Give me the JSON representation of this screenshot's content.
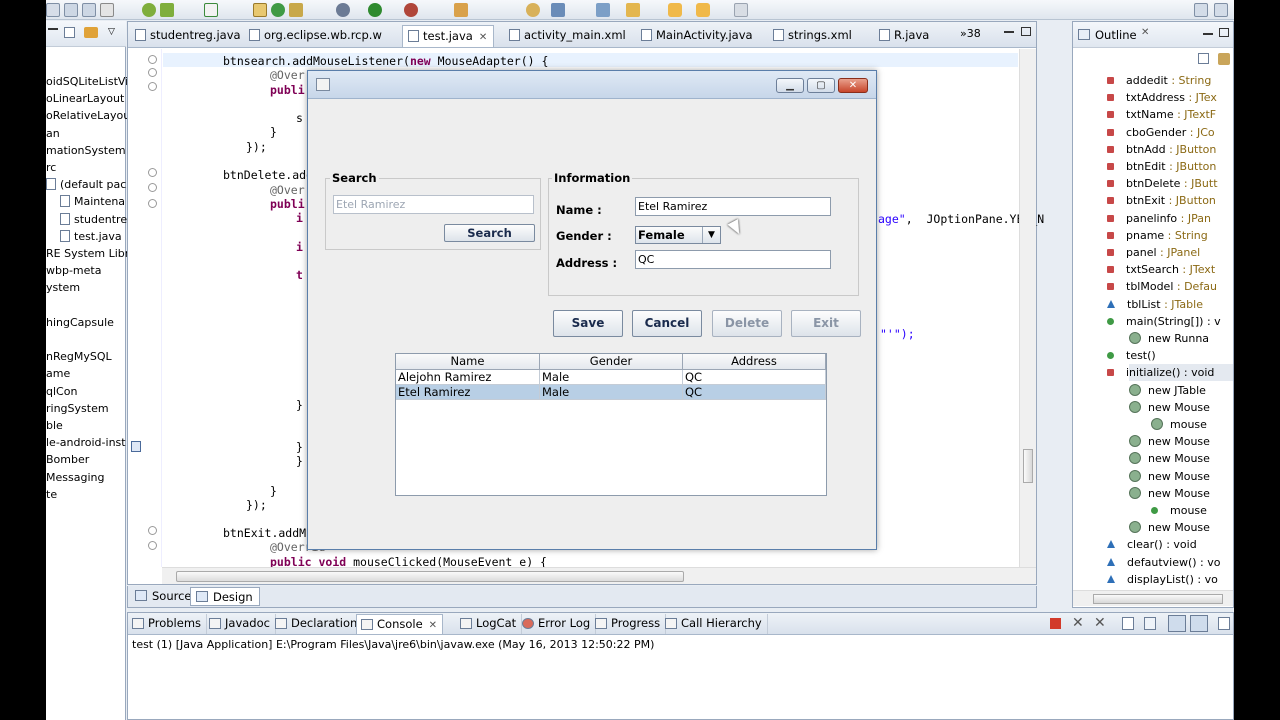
{
  "editor_tabs": [
    {
      "label": "studentreg.java",
      "active": false
    },
    {
      "label": "org.eclipse.wb.rcp.w",
      "active": false
    },
    {
      "label": "test.java",
      "active": true
    },
    {
      "label": "activity_main.xml",
      "active": false
    },
    {
      "label": "MainActivity.java",
      "active": false
    },
    {
      "label": "strings.xml",
      "active": false
    },
    {
      "label": "R.java",
      "active": false
    }
  ],
  "editor_overflow": "»38",
  "package_tree": [
    "oidSQLiteListVi",
    "oLinearLayout",
    "oRelativeLayout",
    "an",
    "mationSystem",
    "rc",
    "(default pack",
    "Maintena",
    "studentre",
    "test.java",
    "RE System Libra",
    "wbp-meta",
    "ystem",
    "",
    "hingCapsule",
    "",
    "nRegMySQL",
    "ame",
    "qlCon",
    "ringSystem",
    "ble",
    "le-android-inst",
    "Bomber",
    "Messaging",
    "te"
  ],
  "code": {
    "l1_prefix": "btnsearch.addMouseListener(",
    "l1_kw": "new",
    "l1_suffix": " MouseAdapter() {",
    "l2": "@Over",
    "l3": "publi",
    "l4": "s",
    "l5": "}",
    "l6": "});",
    "l7": "btnDelete.add",
    "l8": "@Over",
    "l9": "publi",
    "l10": "i",
    "l11": "i",
    "l12": "t",
    "right1_str": "age\"",
    "right1_rest": ",  JOptionPane.YES_N",
    "right2": "\"'\");",
    "l13": "}",
    "l14": "}",
    "l15": "}",
    "l16": "}",
    "l17": "});",
    "l18": "btnExit.addM",
    "l19": "@Overrid",
    "l20_kw1": "public",
    "l20_kw2": "void",
    "l20_rest": " mouseClicked(MouseEvent e) {"
  },
  "source_design_tabs": {
    "source": "Source",
    "design": "Design"
  },
  "outline": {
    "title": "Outline",
    "items": [
      {
        "kind": "field",
        "name": "addedit",
        "type": " : String"
      },
      {
        "kind": "field",
        "name": "txtAddress",
        "type": " : JTex"
      },
      {
        "kind": "field",
        "name": "txtName",
        "type": " : JTextF"
      },
      {
        "kind": "field",
        "name": "cboGender",
        "type": " : JCo"
      },
      {
        "kind": "field",
        "name": "btnAdd",
        "type": " : JButton"
      },
      {
        "kind": "field",
        "name": "btnEdit",
        "type": " : JButton"
      },
      {
        "kind": "field",
        "name": "btnDelete",
        "type": " : JButt"
      },
      {
        "kind": "field",
        "name": "btnExit",
        "type": " : JButton"
      },
      {
        "kind": "field",
        "name": "panelinfo",
        "type": " : JPan"
      },
      {
        "kind": "field",
        "name": "pname",
        "type": " : String"
      },
      {
        "kind": "field",
        "name": "panel",
        "type": " : JPanel"
      },
      {
        "kind": "field",
        "name": "txtSearch",
        "type": " : JText"
      },
      {
        "kind": "field",
        "name": "tblModel",
        "type": " : Defau"
      },
      {
        "kind": "tri",
        "name": "tblList",
        "type": " : JTable"
      },
      {
        "kind": "method",
        "name": "main(String[]) : v",
        "type": ""
      },
      {
        "kind": "anon",
        "name": "new Runna",
        "type": ""
      },
      {
        "kind": "method",
        "name": "test()",
        "type": ""
      },
      {
        "kind": "field",
        "name": "initialize() : void",
        "type": ""
      },
      {
        "kind": "anon",
        "name": "new JTable",
        "type": ""
      },
      {
        "kind": "anon",
        "name": "new Mouse",
        "type": ""
      },
      {
        "kind": "anon",
        "name": "mouse",
        "type": ""
      },
      {
        "kind": "anon",
        "name": "new Mouse",
        "type": ""
      },
      {
        "kind": "anon",
        "name": "new Mouse",
        "type": ""
      },
      {
        "kind": "anon",
        "name": "new Mouse",
        "type": ""
      },
      {
        "kind": "anon",
        "name": "new Mouse",
        "type": ""
      },
      {
        "kind": "method",
        "name": "mouse",
        "type": ""
      },
      {
        "kind": "anon",
        "name": "new Mouse",
        "type": ""
      },
      {
        "kind": "tri",
        "name": "clear() : void",
        "type": ""
      },
      {
        "kind": "tri",
        "name": "defautview() : vo",
        "type": ""
      },
      {
        "kind": "tri",
        "name": "displayList() : vo",
        "type": ""
      }
    ]
  },
  "console": {
    "tabs": [
      "Problems",
      "Javadoc",
      "Declaration",
      "Console",
      "LogCat",
      "Error Log",
      "Progress",
      "Call Hierarchy"
    ],
    "active": "Console",
    "text": "test (1) [Java Application] E:\\Program Files\\Java\\jre6\\bin\\javaw.exe (May 16, 2013 12:50:22 PM)"
  },
  "dialog": {
    "search": {
      "group_label": "Search",
      "input_value": "Etel Ramirez",
      "button": "Search"
    },
    "information": {
      "group_label": "Information",
      "name_label": "Name :",
      "name_value": "Etel Ramirez",
      "gender_label": "Gender :",
      "gender_value": "Female",
      "address_label": "Address :",
      "address_value": "QC"
    },
    "buttons": {
      "save": "Save",
      "cancel": "Cancel",
      "delete": "Delete",
      "exit": "Exit"
    },
    "table": {
      "columns": [
        "Name",
        "Gender",
        "Address"
      ],
      "rows": [
        [
          "Alejohn Ramirez",
          "Male",
          "QC"
        ],
        [
          "Etel Ramirez",
          "Male",
          "QC"
        ]
      ]
    }
  },
  "colors": {
    "selection": "#b8cfe5",
    "keyword": "#7f0055",
    "string": "#2a00ff",
    "field_icon": "#c74848",
    "method_icon": "#3f9a45"
  }
}
